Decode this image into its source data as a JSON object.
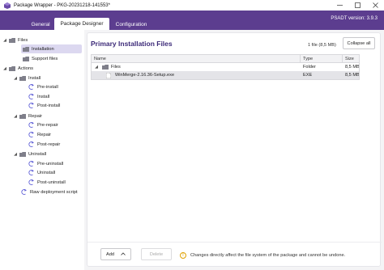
{
  "window": {
    "title": "Package Wrapper - PKG-20231218-141553*"
  },
  "tabs": [
    "General",
    "Package Designer",
    "Configuration"
  ],
  "psadt_version": "PSADT version: 3.9.3",
  "sidebar": {
    "files_label": "Files",
    "installation": "Installation",
    "support_files": "Support files",
    "actions_label": "Actions",
    "install": "Install",
    "pre_install": "Pre-install",
    "install_step": "Install",
    "post_install": "Post-install",
    "repair": "Repair",
    "pre_repair": "Pre-repair",
    "repair_step": "Repair",
    "post_repair": "Post-repair",
    "uninstall": "Uninstall",
    "pre_uninstall": "Pre-uninstall",
    "uninstall_step": "Uninstall",
    "post_uninstall": "Post-uninstall",
    "raw_deployment": "Raw deployment script"
  },
  "main": {
    "title": "Primary Installation Files",
    "file_count": "1 file (8,5 MB)",
    "collapse_all": "Collapse all",
    "columns": [
      "Name",
      "Type",
      "Size"
    ],
    "rows": [
      {
        "name": "Files",
        "type": "Folder",
        "size": "8,5 MB"
      },
      {
        "name": "WinMerge-2.16.36-Setup.exe",
        "type": "EXE",
        "size": "8,5 MB"
      }
    ],
    "add_label": "Add",
    "delete_label": "Delete",
    "warning": "Changes directly affect the file system of the package and cannot be undone."
  },
  "colors": {
    "accent": "#5c3d8f",
    "title": "#3c2a78",
    "selection": "#dcd8f0",
    "warning": "#e0a100"
  }
}
